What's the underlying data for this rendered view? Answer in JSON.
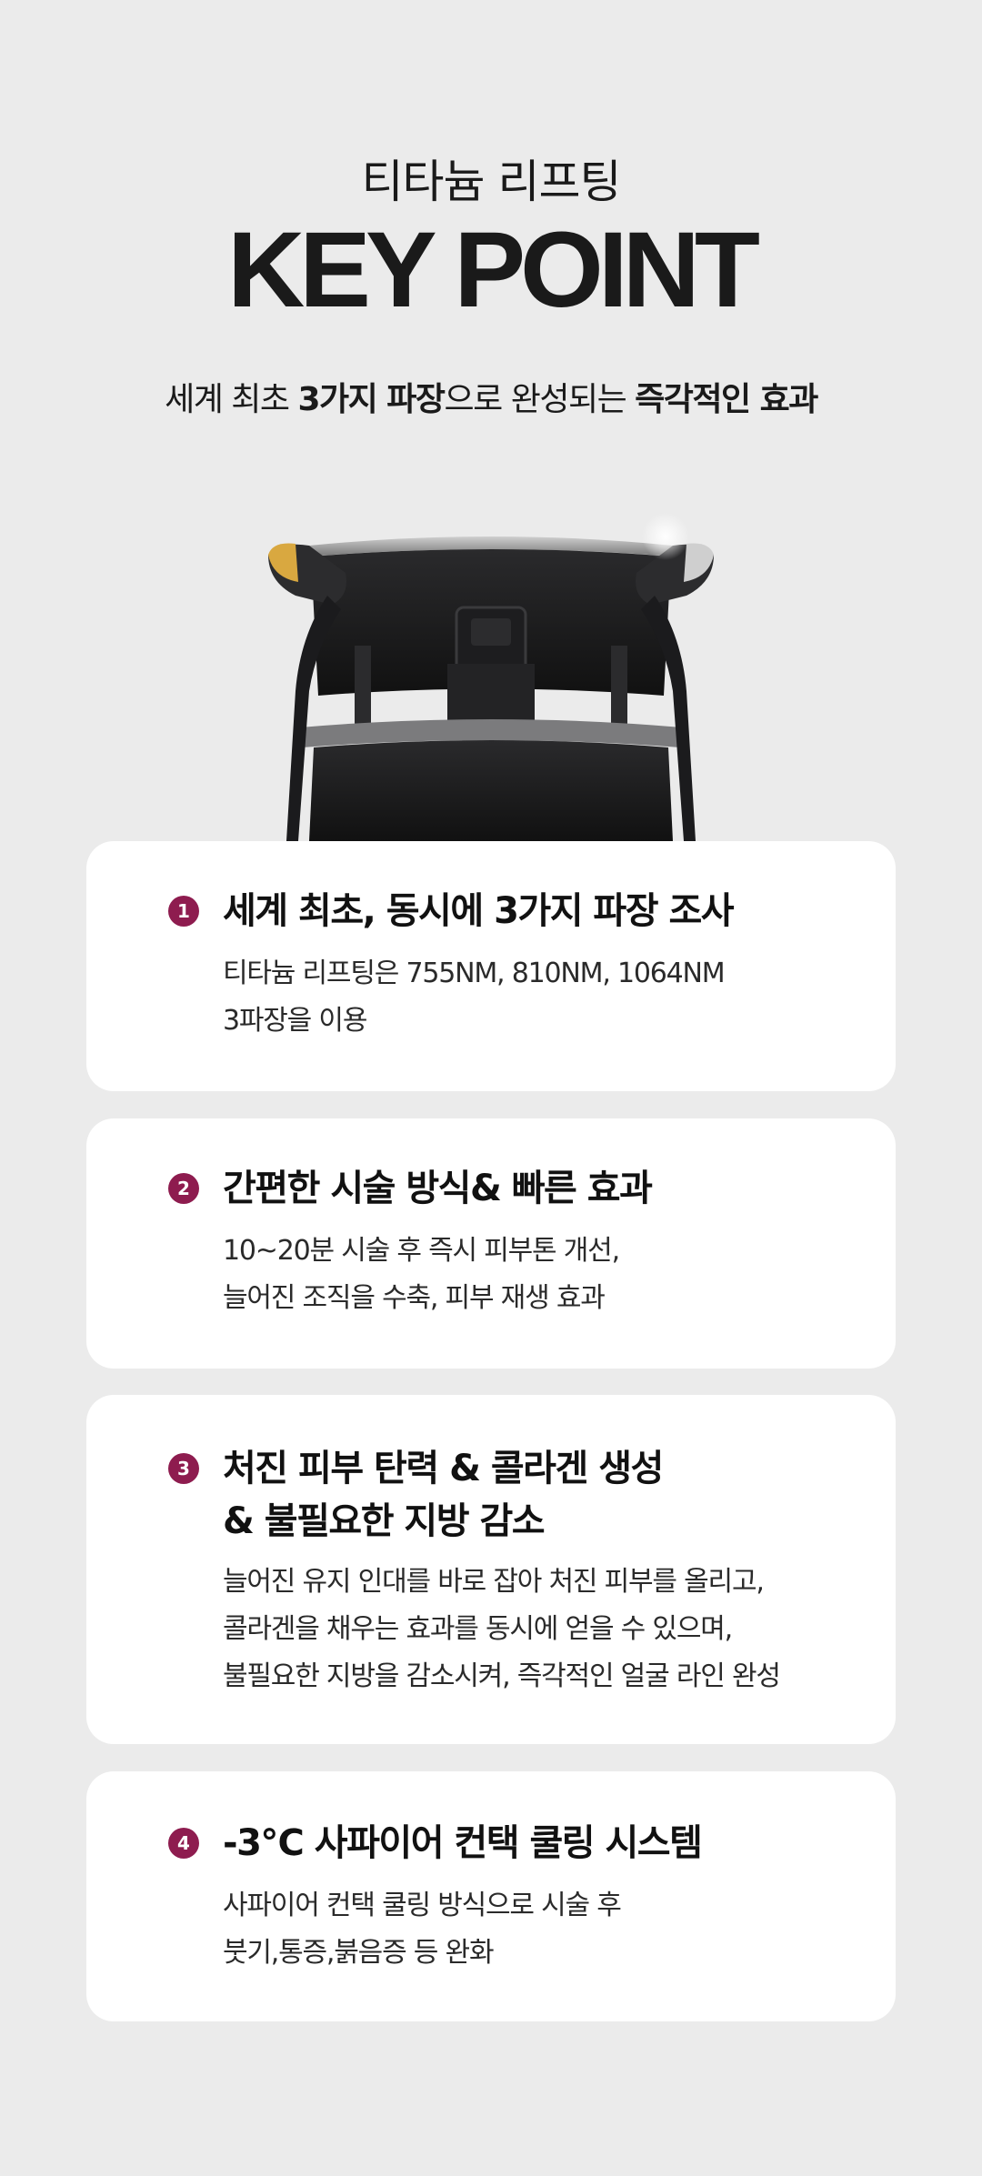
{
  "header": {
    "subtitle": "티타늄 리프팅",
    "title": "KEY POINT",
    "tagline_parts": [
      "세계 최초 ",
      "3가지 파장",
      "으로 완성되는 ",
      "즉각적인 효과"
    ]
  },
  "device_image_alt": "titanium-lifting-device",
  "accent_color": "#8e1c4f",
  "cards": [
    {
      "number": "1",
      "title_lines": [
        "세계 최초, 동시에 3가지 파장 조사"
      ],
      "desc_lines": [
        "티타늄 리프팅은 755NM, 810NM, 1064NM",
        "3파장을 이용"
      ]
    },
    {
      "number": "2",
      "title_lines": [
        "간편한 시술 방식& 빠른 효과"
      ],
      "desc_lines": [
        "10~20분 시술 후 즉시 피부톤 개선,",
        "늘어진 조직을 수축, 피부 재생 효과"
      ]
    },
    {
      "number": "3",
      "title_lines": [
        "처진 피부 탄력 & 콜라겐 생성",
        "& 불필요한 지방 감소"
      ],
      "desc_lines": [
        "늘어진 유지 인대를 바로 잡아 처진 피부를 올리고,",
        "콜라겐을 채우는 효과를 동시에 얻을 수 있으며,",
        "불필요한 지방을 감소시켜, 즉각적인 얼굴 라인 완성"
      ]
    },
    {
      "number": "4",
      "title_lines": [
        "-3℃ 사파이어 컨택 쿨링 시스템"
      ],
      "desc_lines": [
        "사파이어 컨택 쿨링 방식으로 시술 후",
        "붓기,통증,붉음증 등 완화"
      ]
    }
  ]
}
